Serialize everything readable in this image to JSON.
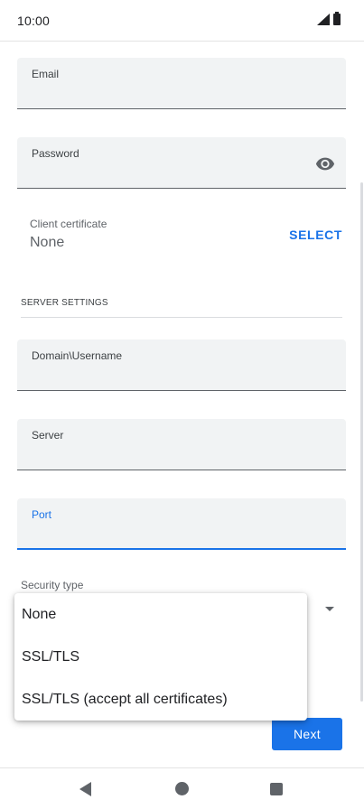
{
  "status_bar": {
    "time": "10:00"
  },
  "form": {
    "email": {
      "label": "Email",
      "value": ""
    },
    "password": {
      "label": "Password",
      "value": "",
      "icon": "eye-icon"
    },
    "client_certificate": {
      "label": "Client certificate",
      "value": "None",
      "action": "SELECT"
    },
    "server_settings": {
      "header": "SERVER SETTINGS"
    },
    "domain_username": {
      "label": "Domain\\Username",
      "value": ""
    },
    "server": {
      "label": "Server",
      "value": ""
    },
    "port": {
      "label": "Port",
      "value": ""
    },
    "security_type": {
      "label": "Security type"
    }
  },
  "security_menu": {
    "options": [
      "None",
      "SSL/TLS",
      "SSL/TLS (accept all certificates)"
    ]
  },
  "actions": {
    "next_label": "Next"
  },
  "colors": {
    "accent": "#1a73e8",
    "field_bg": "#f1f3f4",
    "text": "#202124"
  },
  "nav_bar": {
    "icons": [
      "back-icon",
      "home-icon",
      "recents-icon"
    ]
  }
}
